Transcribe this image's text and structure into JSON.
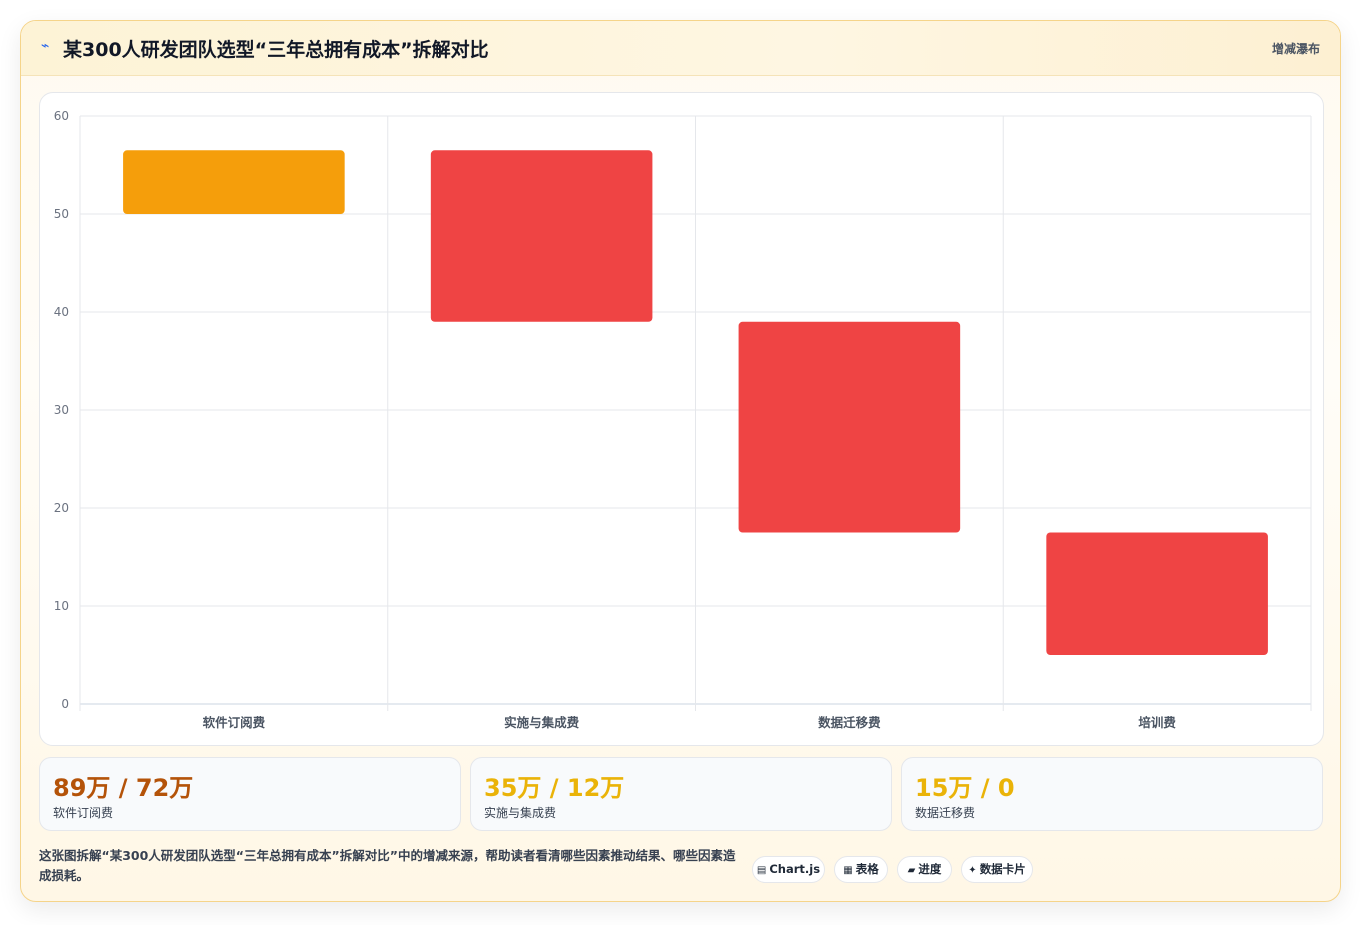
{
  "header": {
    "title": "某300人研发团队选型“三年总拥有成本”拆解对比",
    "title_icon": "chart-line-icon",
    "badge": "增减瀑布"
  },
  "chart_data": {
    "type": "bar",
    "subtype": "waterfall",
    "categories": [
      "软件订阅费",
      "实施与集成费",
      "数据迁移费",
      "培训费"
    ],
    "ranges": [
      [
        50,
        56.5
      ],
      [
        39,
        56.5
      ],
      [
        17.5,
        39
      ],
      [
        5,
        17.5
      ]
    ],
    "colors": [
      "#f59e0b",
      "#ef4444",
      "#ef4444",
      "#ef4444"
    ],
    "ylim": [
      0,
      60
    ],
    "yticks": [
      0,
      10,
      20,
      30,
      40,
      50,
      60
    ],
    "grid": true,
    "xlabel": "",
    "ylabel": ""
  },
  "stats": [
    {
      "value": "89万 / 72万",
      "label": "软件订阅费",
      "color": "#b45309"
    },
    {
      "value": "35万 / 12万",
      "label": "实施与集成费",
      "color": "#eab308"
    },
    {
      "value": "15万 / 0",
      "label": "数据迁移费",
      "color": "#eab308"
    }
  ],
  "footer": {
    "description": "这张图拆解“某300人研发团队选型“三年总拥有成本”拆解对比”中的增减来源，帮助读者看清哪些因素推动结果、哪些因素造成损耗。",
    "tags": [
      {
        "icon": "chart-icon",
        "glyph": "▤",
        "label": "Chart.js"
      },
      {
        "icon": "table-icon",
        "glyph": "▦",
        "label": "表格"
      },
      {
        "icon": "progress-icon",
        "glyph": "▰",
        "label": "进度"
      },
      {
        "icon": "sparkle-icon",
        "glyph": "✦",
        "label": "数据卡片"
      }
    ]
  }
}
